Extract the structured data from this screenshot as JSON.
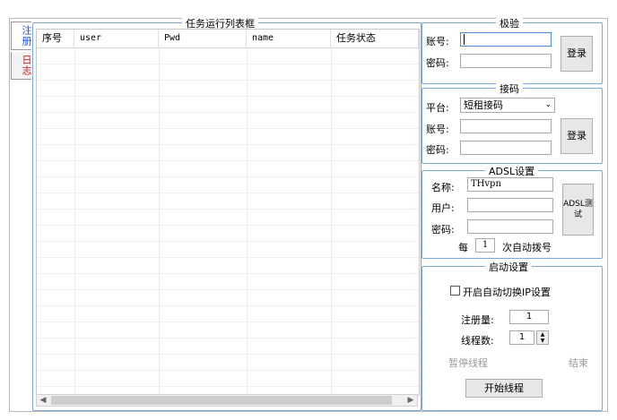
{
  "tabs": {
    "register": "注册",
    "log": "日志"
  },
  "task_table": {
    "title": "任务运行列表框",
    "columns": [
      "序号",
      "user",
      "Pwd",
      "name",
      "任务状态"
    ]
  },
  "jiyan": {
    "title": "极验",
    "account_label": "账号:",
    "password_label": "密码:",
    "account_value": "",
    "password_value": "",
    "login_label": "登录"
  },
  "sms": {
    "title": "接码",
    "platform_label": "平台:",
    "platform_value": "短租接码",
    "account_label": "账号:",
    "password_label": "密码:",
    "login_label": "登录"
  },
  "adsl": {
    "title": "ADSL设置",
    "name_label": "名称:",
    "name_value": "THvpn",
    "user_label": "用户:",
    "password_label": "密码:",
    "test_label": "ADSL测试",
    "every_label": "每",
    "every_value": "1",
    "redial_label": "次自动拨号"
  },
  "startup": {
    "title": "启动设置",
    "auto_ip_label": "开启自动切换IP设置",
    "register_count_label": "注册量:",
    "register_count_value": "1",
    "threads_label": "线程数:",
    "threads_value": "1",
    "pause_label": "暂停线程",
    "end_label": "结束",
    "start_label": "开始线程"
  },
  "colors": {
    "group_border": "#7aa7e0",
    "tab_register": "#1f4fd6",
    "tab_log": "#d02020"
  }
}
